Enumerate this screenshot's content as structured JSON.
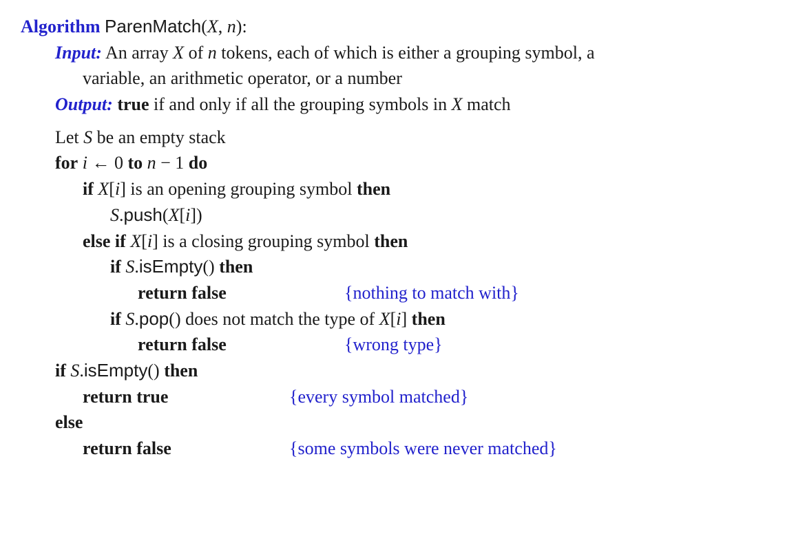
{
  "header": {
    "kw_algorithm": "Algorithm",
    "name": "ParenMatch",
    "params_open": "(",
    "param1": "X",
    "comma": ", ",
    "param2": "n",
    "params_close": "):"
  },
  "input": {
    "kw": "Input:",
    "line1_a": "  An array ",
    "line1_X": "X",
    "line1_b": " of ",
    "line1_n": "n",
    "line1_c": " tokens, each of which is either a grouping symbol, a",
    "line2": "variable, an arithmetic operator, or a number"
  },
  "output": {
    "kw": "Output:",
    "space": " ",
    "true": "true",
    "rest_a": " if and only if all the grouping symbols in ",
    "X": "X",
    "rest_b": " match"
  },
  "body": {
    "let_a": "Let ",
    "let_S": "S",
    "let_b": " be an empty stack",
    "for_kw": "for",
    "for_sp": " ",
    "for_i": "i",
    "for_arrow": " ← 0 ",
    "for_to": "to",
    "for_n": " n",
    "for_minus": " − 1 ",
    "for_do": "do",
    "if1_kw": "if",
    "if1_sp": " ",
    "if1_Xi": "X",
    "if1_br_open": "[",
    "if1_i": "i",
    "if1_br_close": "]",
    "if1_rest": " is an opening grouping symbol ",
    "if1_then": "then",
    "push_S": "S",
    "push_dot": ".",
    "push_fn": "push",
    "push_open": "(",
    "push_X": "X",
    "push_bo": "[",
    "push_i": "i",
    "push_bc": "])",
    "elseif_kw": "else if",
    "elseif_sp": " ",
    "elseif_X": "X",
    "elseif_bo": "[",
    "elseif_i": "i",
    "elseif_bc": "]",
    "elseif_rest": " is a closing grouping symbol ",
    "elseif_then": "then",
    "if2_kw": "if",
    "if2_sp": " ",
    "if2_S": "S",
    "if2_dot": ".",
    "if2_fn": "isEmpty",
    "if2_paren": "() ",
    "if2_then": "then",
    "ret1_kw": "return false",
    "ret1_comment": "{nothing to match with}",
    "if3_kw": "if",
    "if3_sp": " ",
    "if3_S": "S",
    "if3_dot": ".",
    "if3_fn": "pop",
    "if3_paren": "() does not match the type of ",
    "if3_X": "X",
    "if3_bo": "[",
    "if3_i": "i",
    "if3_bc": "] ",
    "if3_then": "then",
    "ret2_kw": "return false",
    "ret2_comment": "{wrong type}",
    "if4_kw": "if",
    "if4_sp": " ",
    "if4_S": "S",
    "if4_dot": ".",
    "if4_fn": "isEmpty",
    "if4_paren": "() ",
    "if4_then": "then",
    "ret3_kw": "return true",
    "ret3_comment": "{every symbol matched}",
    "else_kw": "else",
    "ret4_kw": "return false",
    "ret4_comment": "{some symbols were never matched}"
  }
}
